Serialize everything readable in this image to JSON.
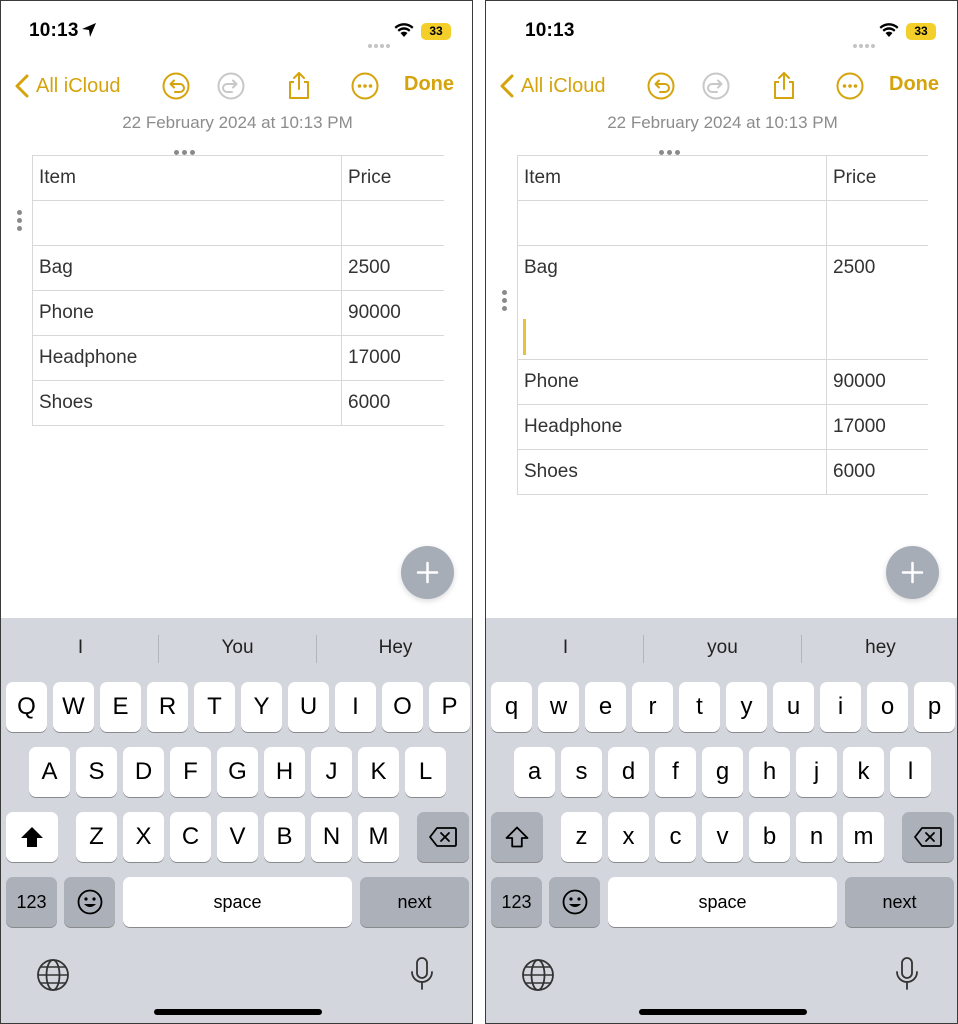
{
  "left_screen": {
    "status": {
      "time": "10:13",
      "battery": "33"
    },
    "nav": {
      "back_label": "All iCloud",
      "done_label": "Done"
    },
    "date": "22 February 2024 at 10:13 PM",
    "table": {
      "rows": [
        [
          "Item",
          "Price"
        ],
        [
          "",
          ""
        ],
        [
          "Bag",
          "2500"
        ],
        [
          "Phone",
          "90000"
        ],
        [
          "Headphone",
          "17000"
        ],
        [
          "Shoes",
          "6000"
        ]
      ]
    },
    "keyboard": {
      "suggestions": [
        "I",
        "You",
        "Hey"
      ],
      "row1": [
        "Q",
        "W",
        "E",
        "R",
        "T",
        "Y",
        "U",
        "I",
        "O",
        "P"
      ],
      "row2": [
        "A",
        "S",
        "D",
        "F",
        "G",
        "H",
        "J",
        "K",
        "L"
      ],
      "row3": [
        "Z",
        "X",
        "C",
        "V",
        "B",
        "N",
        "M"
      ],
      "numbers_key": "123",
      "space_key": "space",
      "return_key": "next"
    }
  },
  "right_screen": {
    "status": {
      "time": "10:13",
      "battery": "33"
    },
    "nav": {
      "back_label": "All iCloud",
      "done_label": "Done"
    },
    "date": "22 February 2024 at 10:13 PM",
    "table": {
      "rows": [
        [
          "Item",
          "Price"
        ],
        [
          "",
          ""
        ],
        [
          "Bag",
          "2500"
        ],
        [
          "Phone",
          "90000"
        ],
        [
          "Headphone",
          "17000"
        ],
        [
          "Shoes",
          "6000"
        ]
      ]
    },
    "keyboard": {
      "suggestions": [
        "I",
        "you",
        "hey"
      ],
      "row1": [
        "q",
        "w",
        "e",
        "r",
        "t",
        "y",
        "u",
        "i",
        "o",
        "p"
      ],
      "row2": [
        "a",
        "s",
        "d",
        "f",
        "g",
        "h",
        "j",
        "k",
        "l"
      ],
      "row3": [
        "z",
        "x",
        "c",
        "v",
        "b",
        "n",
        "m"
      ],
      "numbers_key": "123",
      "space_key": "space",
      "return_key": "next"
    }
  },
  "colors": {
    "accent": "#d5a40c",
    "keyboard_bg": "#d3d6dc",
    "caret": "#e6c235"
  },
  "icons": [
    "location-arrow-icon",
    "wifi-icon",
    "back-chevron-icon",
    "undo-icon",
    "redo-icon",
    "share-icon",
    "more-icon",
    "plus-icon",
    "shift-icon",
    "delete-icon",
    "emoji-icon",
    "globe-icon",
    "microphone-icon"
  ]
}
